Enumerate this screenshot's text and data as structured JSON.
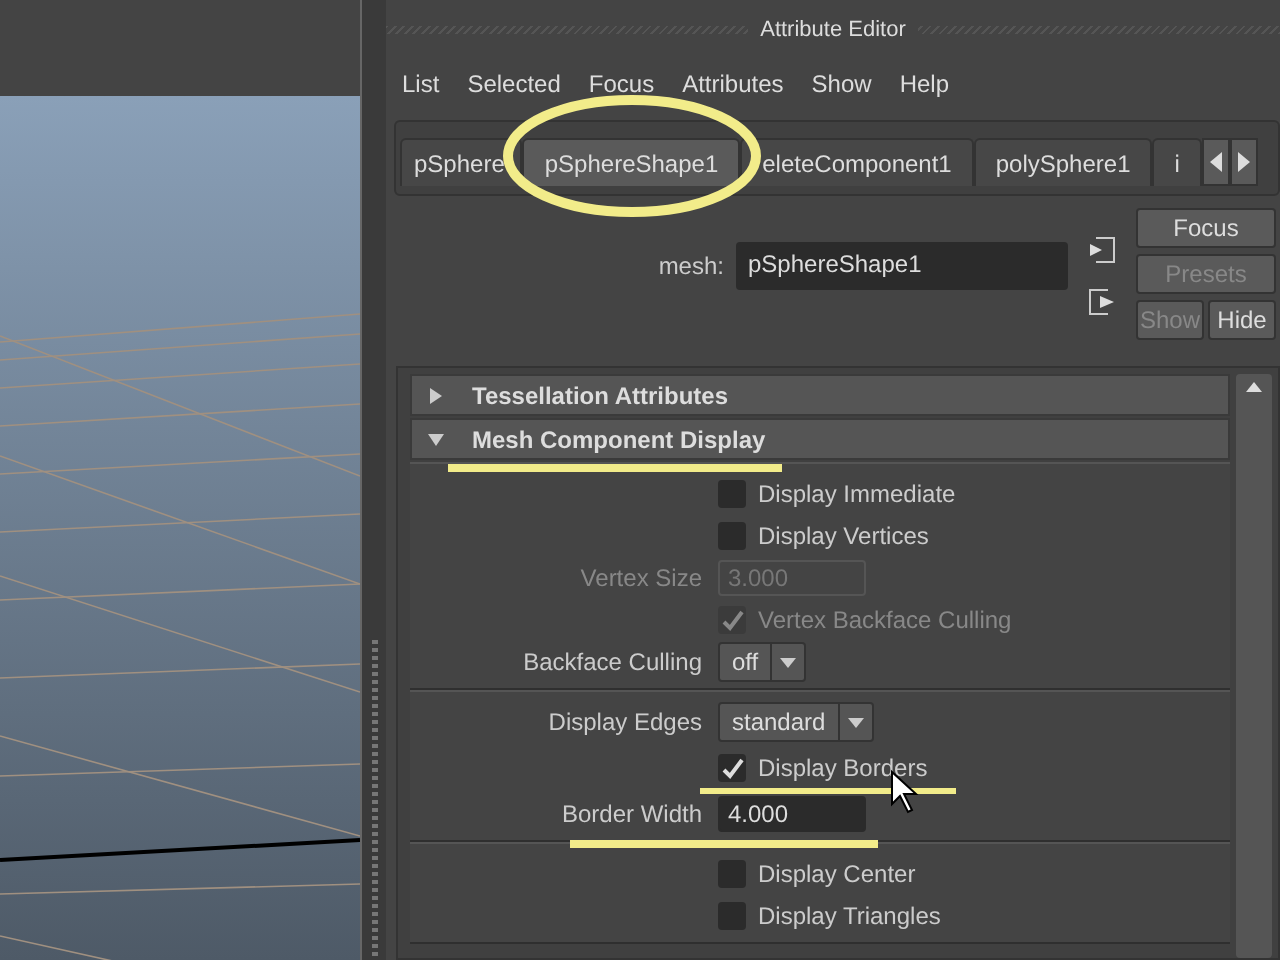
{
  "window": {
    "title": "Attribute Editor"
  },
  "menu": [
    "List",
    "Selected",
    "Focus",
    "Attributes",
    "Show",
    "Help"
  ],
  "tabs": [
    {
      "label": "pSphere",
      "selected": false
    },
    {
      "label": "pSphereShape1",
      "selected": true
    },
    {
      "label": "eleteComponent1",
      "selected": false
    },
    {
      "label": "polySphere1",
      "selected": false
    },
    {
      "label": "i",
      "selected": false
    }
  ],
  "node": {
    "label": "mesh:",
    "value": "pSphereShape1"
  },
  "side_buttons": [
    {
      "label": "Focus",
      "disabled": false
    },
    {
      "label": "Presets",
      "disabled": true
    }
  ],
  "show_hide": [
    {
      "label": "Show",
      "disabled": true
    },
    {
      "label": "Hide",
      "disabled": false
    }
  ],
  "sections": [
    {
      "title": "Tessellation Attributes",
      "expanded": false
    },
    {
      "title": "Mesh Component Display",
      "expanded": true
    }
  ],
  "groups": [
    {
      "rows": [
        {
          "kind": "checkbox",
          "label": "Display Immediate",
          "checked": false,
          "disabled": false
        },
        {
          "kind": "checkbox",
          "label": "Display Vertices",
          "checked": false,
          "disabled": false
        },
        {
          "kind": "field",
          "label": "Vertex Size",
          "value": "3.000",
          "disabled": true
        },
        {
          "kind": "checkbox",
          "label": "Vertex Backface Culling",
          "checked": true,
          "disabled": true
        },
        {
          "kind": "dropdown",
          "label": "Backface Culling",
          "value": "off"
        }
      ]
    },
    {
      "rows": [
        {
          "kind": "dropdown",
          "label": "Display Edges",
          "value": "standard"
        },
        {
          "kind": "checkbox",
          "label": "Display Borders",
          "checked": true,
          "disabled": false
        },
        {
          "kind": "field",
          "label": "Border Width",
          "value": "4.000",
          "disabled": false
        }
      ]
    },
    {
      "rows": [
        {
          "kind": "checkbox",
          "label": "Display Center",
          "checked": false,
          "disabled": false
        },
        {
          "kind": "checkbox",
          "label": "Display Triangles",
          "checked": false,
          "disabled": false
        }
      ]
    }
  ]
}
